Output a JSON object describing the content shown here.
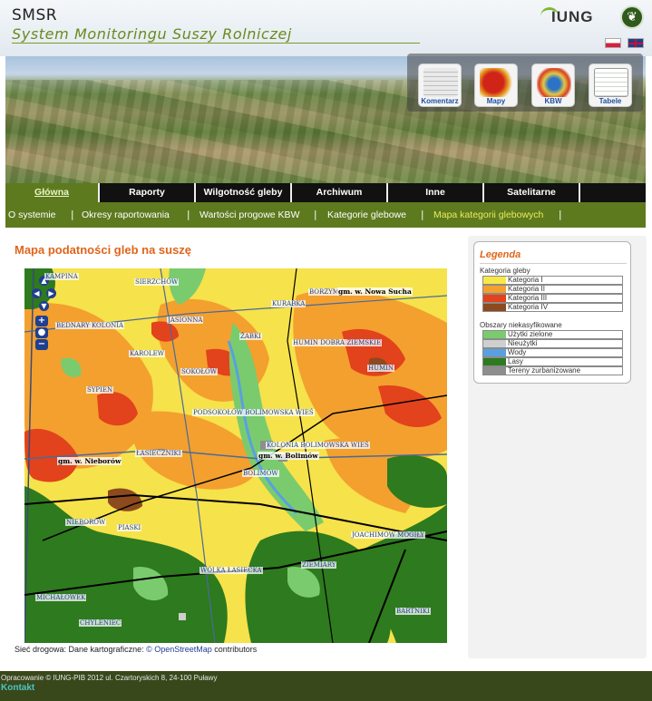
{
  "header": {
    "abbr": "SMSR",
    "title": "System Monitoringu Suszy Rolniczej",
    "logo_text": "IUNG",
    "seal_icon": "leaf-seal-icon",
    "languages": [
      "pl",
      "en"
    ]
  },
  "banner": {
    "tiles": [
      {
        "label": "Komentarz",
        "preview": "Komentarz Instytut Upr Obu"
      },
      {
        "label": "Mapy"
      },
      {
        "label": "KBW"
      },
      {
        "label": "Tabele"
      }
    ]
  },
  "main_nav": {
    "tabs": [
      "Główna",
      "Raporty",
      "Wilgotność gleby",
      "Archiwum",
      "Inne",
      "Satelitarne"
    ],
    "active": "Główna"
  },
  "sub_nav": {
    "items": [
      "O systemie",
      "Okresy raportowania",
      "Wartości progowe KBW",
      "Kategorie glebowe",
      "Mapa kategorii glebowych"
    ],
    "current": "Mapa kategorii glebowych"
  },
  "content": {
    "title": "Mapa podatności gleb na suszę",
    "places": [
      "KAMPINA",
      "SIERZCHÓW",
      "BORZYM",
      "KURABKA",
      "BEDNARY KOLONIA",
      "JASIONNA",
      "ŻABKI",
      "KAROLEW",
      "HUMIN DOBRA ZIEMSKIE",
      "HUMIN",
      "SOKOŁÓW",
      "SYPIEŃ",
      "PODSOKOŁÓW BOLIMOWSKA WIEŚ",
      "KOLONIA BOLIMOWSKA WIEŚ",
      "ŁASIECZNIKI",
      "BOLIMÓW",
      "NIEBORÓW",
      "PIASKI",
      "JOACHIMÓW MOGIŁY",
      "WÓLKA ŁASIECKA",
      "ZIEMIARY",
      "MICHAŁÓWEK",
      "CHYLENIEC",
      "BARTNIKI"
    ],
    "gminy": [
      "gm. w. Nowa Sucha",
      "gm. w. Bolimów",
      "gm. w. Nieborów"
    ],
    "credit_prefix": "Sieć drogowa: Dane kartograficzne:",
    "credit_link": "© OpenStreetMap",
    "credit_suffix": "contributors"
  },
  "legend": {
    "title": "Legenda",
    "section1": "Kategoria gleby",
    "soil": [
      {
        "label": "Kategoria I",
        "color": "#f7e84a"
      },
      {
        "label": "Kategoria II",
        "color": "#f3a02f"
      },
      {
        "label": "Kategoria III",
        "color": "#e2421c"
      },
      {
        "label": "Kategoria IV",
        "color": "#8c4a1e"
      }
    ],
    "section2": "Obszary niekasyfikowane",
    "other": [
      {
        "label": "Użytki zielone",
        "color": "#7acb6e"
      },
      {
        "label": "Nieużytki",
        "color": "#cfcfcf"
      },
      {
        "label": "Wody",
        "color": "#5aa0e0"
      },
      {
        "label": "Lasy",
        "color": "#2e7a1e"
      },
      {
        "label": "Tereny zurbanizowane",
        "color": "#8e8e8e"
      }
    ]
  },
  "footer": {
    "copyright": "Opracowanie © IUNG-PIB 2012 ul. Czartoryskich 8, 24-100 Puławy",
    "contact": "Kontakt"
  }
}
